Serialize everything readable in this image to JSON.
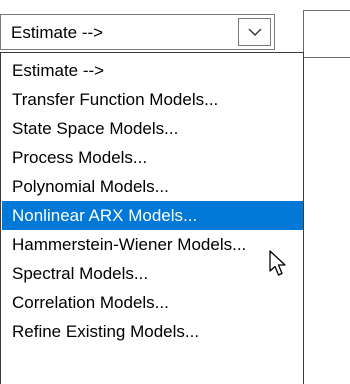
{
  "combo": {
    "selected_value": "Estimate -->",
    "arrow_icon": "chevron-down-icon"
  },
  "dropdown": {
    "items": [
      {
        "label": "Estimate -->",
        "selected": false
      },
      {
        "label": "Transfer Function Models...",
        "selected": false
      },
      {
        "label": "State Space Models...",
        "selected": false
      },
      {
        "label": "Process Models...",
        "selected": false
      },
      {
        "label": "Polynomial Models...",
        "selected": false
      },
      {
        "label": "Nonlinear ARX Models...",
        "selected": true
      },
      {
        "label": "Hammerstein-Wiener Models...",
        "selected": false
      },
      {
        "label": "Spectral Models...",
        "selected": false
      },
      {
        "label": "Correlation Models...",
        "selected": false
      },
      {
        "label": "Refine Existing Models...",
        "selected": false
      }
    ]
  },
  "colors": {
    "highlight": "#0078d7",
    "highlight_text": "#ffffff",
    "text": "#000000",
    "border": "#7a7a7a"
  },
  "cursor_icon": "mouse-pointer-icon"
}
